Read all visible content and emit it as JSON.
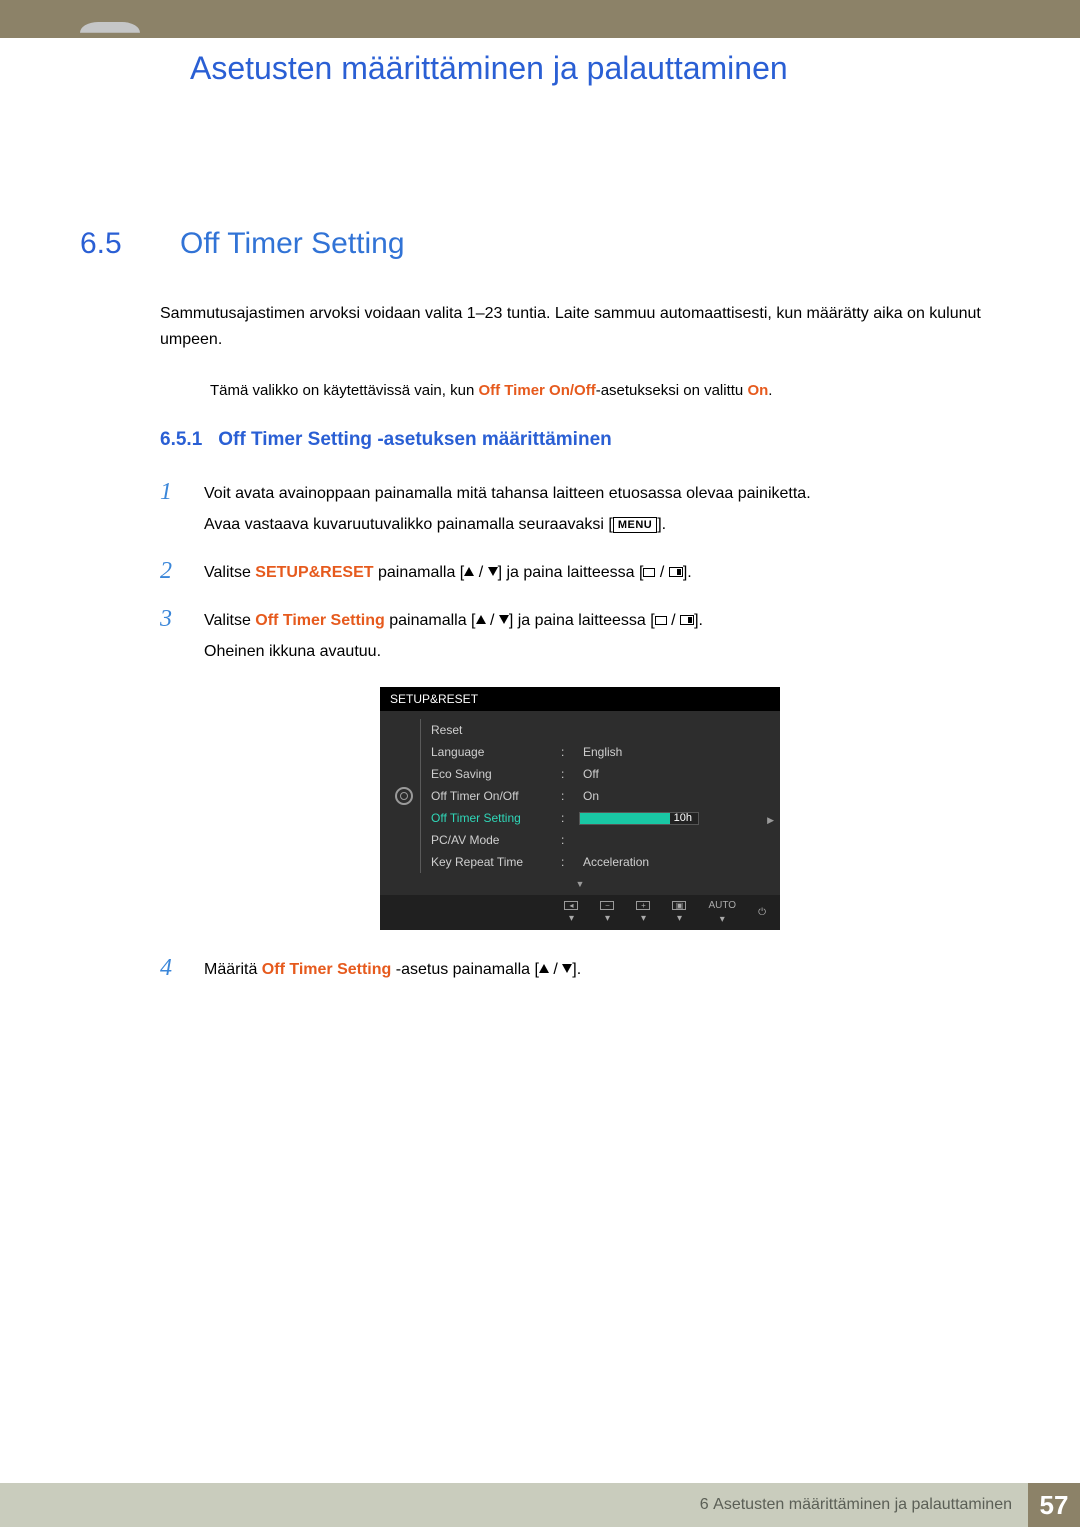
{
  "header": {
    "chapter_title": "Asetusten määrittäminen ja palauttaminen"
  },
  "section": {
    "number": "6.5",
    "title": "Off Timer Setting",
    "intro": "Sammutusajastimen arvoksi voidaan valita 1–23 tuntia. Laite sammuu automaattisesti, kun määrätty aika on kulunut umpeen.",
    "note_prefix": "Tämä valikko on käytettävissä vain, kun ",
    "note_ref1": "Off Timer On/Off",
    "note_mid": "-asetukseksi on valittu ",
    "note_ref2": "On",
    "note_suffix": "."
  },
  "subsection": {
    "number": "6.5.1",
    "title": "Off Timer Setting -asetuksen määrittäminen"
  },
  "steps": {
    "s1": {
      "num": "1",
      "line1": "Voit avata avainoppaan painamalla mitä tahansa laitteen etuosassa olevaa painiketta.",
      "line2_a": "Avaa vastaava kuvaruutuvalikko painamalla seuraavaksi [",
      "line2_menu": "MENU",
      "line2_b": "]."
    },
    "s2": {
      "num": "2",
      "a": "Valitse ",
      "b": "SETUP&RESET",
      "c": " painamalla [",
      "d": "] ja paina laitteessa [",
      "e": "]."
    },
    "s3": {
      "num": "3",
      "a": "Valitse ",
      "b": "Off Timer Setting",
      "c": " painamalla [",
      "d": "] ja paina laitteessa [",
      "e": "].",
      "f": "Oheinen ikkuna avautuu."
    },
    "s4": {
      "num": "4",
      "a": "Määritä ",
      "b": "Off Timer Setting",
      "c": " -asetus painamalla [",
      "d": "]."
    }
  },
  "osd": {
    "title": "SETUP&RESET",
    "rows": [
      {
        "label": "Reset",
        "value": ""
      },
      {
        "label": "Language",
        "value": "English"
      },
      {
        "label": "Eco Saving",
        "value": "Off"
      },
      {
        "label": "Off Timer On/Off",
        "value": "On"
      },
      {
        "label": "Off Timer Setting",
        "value": "10h"
      },
      {
        "label": "PC/AV Mode",
        "value": ""
      },
      {
        "label": "Key Repeat Time",
        "value": "Acceleration"
      }
    ],
    "footer_auto": "AUTO"
  },
  "footer": {
    "chapter_index": "6",
    "chapter_name": "Asetusten määrittäminen ja palauttaminen",
    "page_number": "57"
  }
}
